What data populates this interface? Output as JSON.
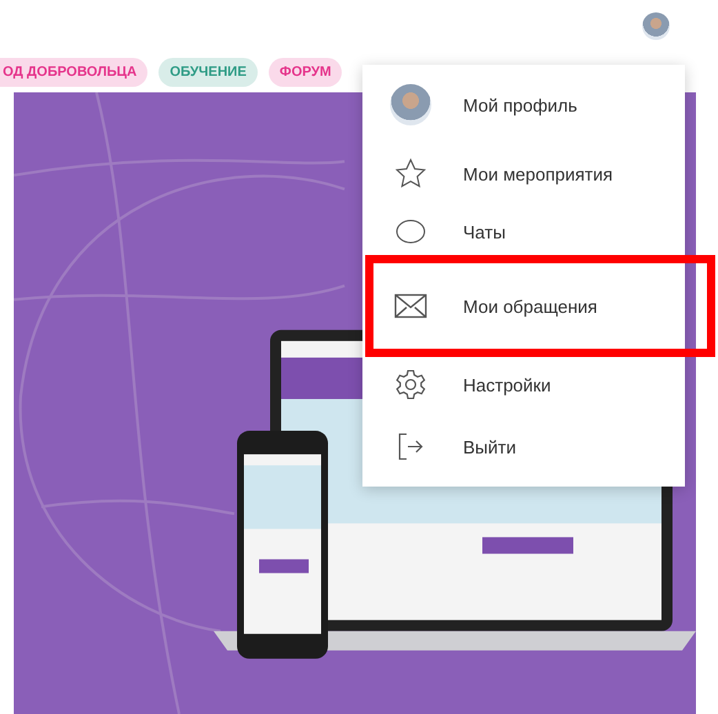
{
  "nav_pills": [
    {
      "label": "ОД ДОБРОВОЛЬЦА",
      "color": "#e5348b"
    },
    {
      "label": "ОБУЧЕНИЕ",
      "color": "#2f9c86"
    },
    {
      "label": "ФОРУМ",
      "color": "#e5348b"
    }
  ],
  "user_menu": {
    "items": [
      {
        "kind": "profile",
        "label": "Мой профиль",
        "highlighted": false
      },
      {
        "kind": "events",
        "label": "Мои мероприятия",
        "highlighted": false
      },
      {
        "kind": "chats",
        "label": "Чаты",
        "highlighted": false
      },
      {
        "kind": "requests",
        "label": "Мои обращения",
        "highlighted": true
      },
      {
        "kind": "settings",
        "label": "Настройки",
        "highlighted": false
      },
      {
        "kind": "logout",
        "label": "Выйти",
        "highlighted": false
      }
    ]
  }
}
